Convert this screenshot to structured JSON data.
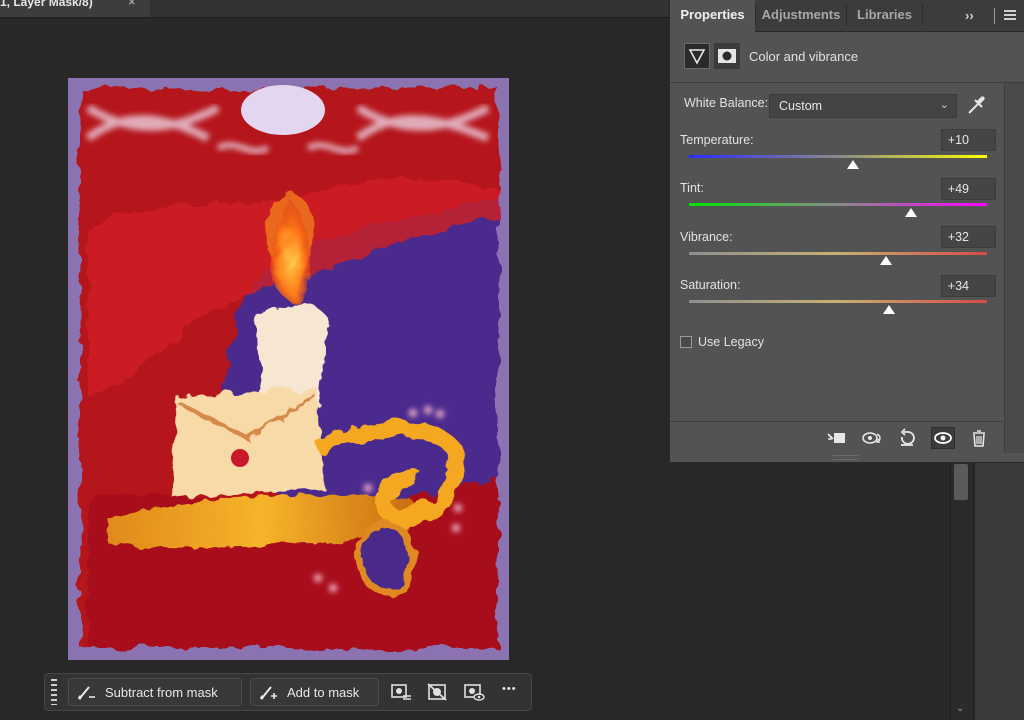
{
  "document": {
    "tab_title": "1, Layer Mask/8)",
    "close_glyph": "×"
  },
  "mask_taskbar": {
    "subtract_label": "Subtract from mask",
    "add_label": "Add to mask",
    "more_glyph": "•••"
  },
  "panel": {
    "tabs": [
      {
        "label": "Properties",
        "active": true
      },
      {
        "label": "Adjustments",
        "active": false
      },
      {
        "label": "Libraries",
        "active": false
      }
    ],
    "collapse_glyph": "››",
    "adjustment_type": "Color and vibrance",
    "white_balance": {
      "label": "White Balance:",
      "value": "Custom"
    },
    "sliders": [
      {
        "label": "Temperature:",
        "value": "+10",
        "level": 0.55
      },
      {
        "label": "Tint:",
        "value": "+49",
        "level": 0.745
      },
      {
        "label": "Vibrance:",
        "value": "+32",
        "level": 0.66
      },
      {
        "label": "Saturation:",
        "value": "+34",
        "level": 0.67
      }
    ],
    "use_legacy": {
      "label": "Use Legacy",
      "checked": false
    }
  },
  "colors": {
    "panel_bg": "#535353",
    "canvas_bg": "#282828",
    "temperature_from": "#2b2bff",
    "temperature_to": "#ffff00",
    "tint_from": "#00e600",
    "tint_to": "#ff00ff"
  }
}
